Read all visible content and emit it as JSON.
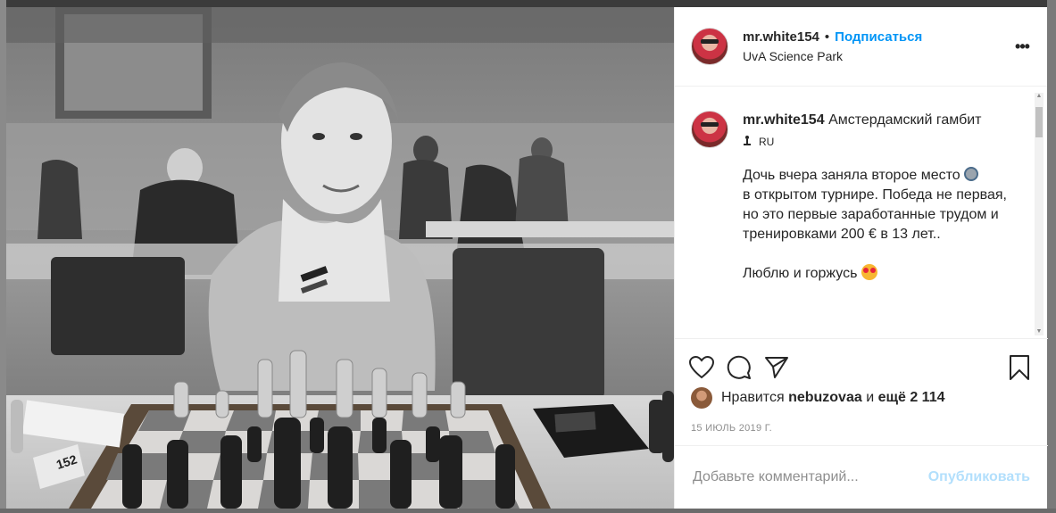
{
  "post": {
    "username": "mr.white154",
    "separator": "•",
    "follow_label": "Подписаться",
    "location": "UvA Science Park",
    "more_label": "•••"
  },
  "caption": {
    "username": "mr.white154",
    "title": "Амстердамский гамбит",
    "translate_label": "RU",
    "line1": "Дочь вчера заняла второе место",
    "line2": "в открытом турнире. Победа не первая, но это первые заработанные трудом и тренировками 200 € в 13 лет..",
    "line3": "Люблю и горжусь"
  },
  "likes": {
    "prefix": "Нравится",
    "user": "nebuzovaa",
    "connector": "и",
    "more": "ещё 2 114"
  },
  "date": "15 ИЮЛЬ 2019 Г.",
  "comment": {
    "placeholder": "Добавьте комментарий...",
    "publish_label": "Опубликовать"
  },
  "board_number": "152",
  "colors": {
    "accent": "#0095f6",
    "publish_disabled": "#b2dffc",
    "text": "#262626",
    "muted": "#8e8e8e"
  },
  "icons": [
    "heart-icon",
    "comment-icon",
    "share-icon",
    "bookmark-icon",
    "translate-icon",
    "medal-emoji-icon",
    "heart-eyes-emoji-icon"
  ]
}
